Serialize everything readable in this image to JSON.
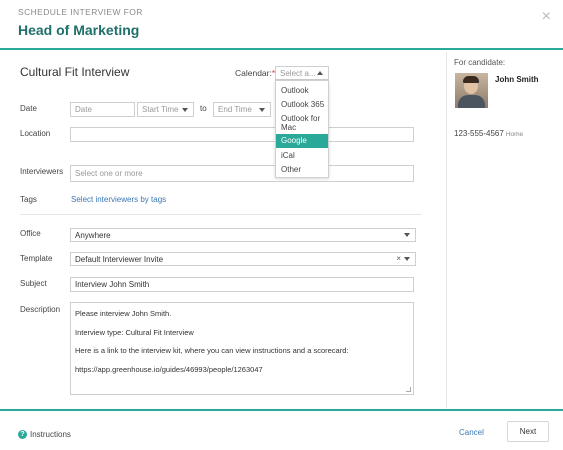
{
  "header": {
    "pretitle": "SCHEDULE INTERVIEW FOR",
    "title": "Head of Marketing",
    "close_icon": "×"
  },
  "main": {
    "interview_title": "Cultural Fit Interview",
    "calendar": {
      "label": "Calendar:",
      "required_mark": "*",
      "placeholder": "Select a...",
      "options": [
        "Outlook",
        "Outlook 365",
        "Outlook for Mac",
        "Google",
        "iCal",
        "Other"
      ],
      "highlighted": "Google"
    },
    "date": {
      "label": "Date",
      "date_placeholder": "Date",
      "start_placeholder": "Start Time",
      "to_label": "to",
      "end_placeholder": "End Time"
    },
    "location": {
      "label": "Location",
      "value": ""
    },
    "interviewers": {
      "label": "Interviewers",
      "placeholder": "Select one or more"
    },
    "tags": {
      "label": "Tags",
      "link": "Select interviewers by tags"
    },
    "office": {
      "label": "Office",
      "value": "Anywhere"
    },
    "template": {
      "label": "Template",
      "value": "Default Interviewer Invite",
      "clear_icon": "×"
    },
    "subject": {
      "label": "Subject",
      "value": "Interview John Smith"
    },
    "description": {
      "label": "Description",
      "lines": [
        "Please interview John Smith.",
        "Interview type: Cultural Fit Interview",
        "Here is a link to the interview kit, where you can view instructions and a scorecard:",
        "https://app.greenhouse.io/guides/46993/people/1263047"
      ]
    }
  },
  "candidate": {
    "label": "For candidate:",
    "name": "John Smith",
    "phone": "123-555-4567",
    "phone_type": "Home"
  },
  "footer": {
    "instructions": "Instructions",
    "help_icon": "?",
    "cancel": "Cancel",
    "next": "Next"
  },
  "colors": {
    "accent": "#2aa898",
    "title": "#1f6f6a",
    "link": "#3a78b5",
    "required": "#dd3333"
  }
}
